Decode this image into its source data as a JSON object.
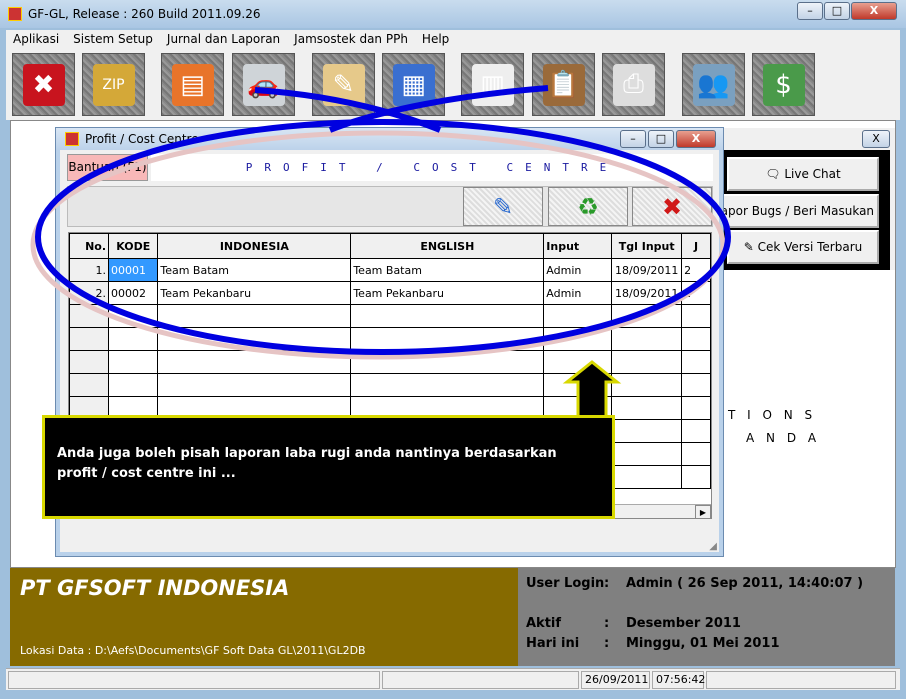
{
  "app": {
    "title": "GF-GL, Release : 260 Build 2011.09.26",
    "min": "–",
    "max": "□",
    "close": "X"
  },
  "menu": [
    "Aplikasi",
    "Sistem Setup",
    "Jurnal dan Laporan",
    "Jamsostek dan PPh",
    "Help"
  ],
  "toolbar": [
    {
      "icon": "exit-icon",
      "glyph": "✖",
      "color": "#c8141e"
    },
    {
      "icon": "zip-box-icon",
      "glyph": "ZIP",
      "color": "#d4a838"
    },
    {
      "icon": "card-index-icon",
      "glyph": "▤",
      "color": "#e8742a"
    },
    {
      "icon": "car-icon",
      "glyph": "🚗",
      "color": "#cfd4d8"
    },
    {
      "icon": "document-icon",
      "glyph": "✎",
      "color": "#e6c98a"
    },
    {
      "icon": "spreadsheet-window-icon",
      "glyph": "▦",
      "color": "#3a6fd0"
    },
    {
      "icon": "papers-stamp-icon",
      "glyph": "▥",
      "color": "#eeeeee"
    },
    {
      "icon": "clipboard-icon",
      "glyph": "📋",
      "color": "#9a6a3a"
    },
    {
      "icon": "printer-icon",
      "glyph": "⎙",
      "color": "#dddddd"
    },
    {
      "icon": "users-icon",
      "glyph": "👥",
      "color": "#7aa0c0"
    },
    {
      "icon": "money-icon",
      "glyph": "$",
      "color": "#4a9a4a"
    }
  ],
  "window": {
    "title": "Profit / Cost Centre",
    "help_button": "Bantuan (F1)",
    "heading": "PROFIT / COST CENTRE"
  },
  "grid": {
    "columns": [
      "No.",
      "KODE",
      "INDONESIA",
      "ENGLISH",
      "Input",
      "Tgl Input",
      "J"
    ],
    "rows": [
      [
        "1.",
        "00001",
        "Team Batam",
        "Team Batam",
        "Admin",
        "18/09/2011",
        "2"
      ],
      [
        "2.",
        "00002",
        "Team Pekanbaru",
        "Team Pekanbaru",
        "Admin",
        "18/09/2011",
        "2"
      ]
    ]
  },
  "right_panel": {
    "close": "X",
    "live_chat": "Live Chat",
    "bug_report": "Lapor Bugs / Beri Masukan",
    "check_version": "Cek Versi Terbaru"
  },
  "background_text": {
    "line1": "T I O N S",
    "line2": "A N D A"
  },
  "callout": {
    "text": "Anda juga boleh pisah laporan laba rugi anda nantinya berdasarkan profit / cost centre ini ..."
  },
  "footer": {
    "company": "PT GFSOFT INDONESIA",
    "data_location": "Lokasi Data :  D:\\Aefs\\Documents\\GF Soft Data GL\\2011\\GL2DB",
    "user_login_label": "User Login",
    "user_login_value": "Admin  ( 26 Sep 2011, 14:40:07 )",
    "active_label": "Aktif",
    "active_value": "Desember 2011",
    "today_label": "Hari ini",
    "today_value": "Minggu, 01 Mei 2011",
    "sep": ":"
  },
  "status": {
    "date": "26/09/2011",
    "time": "07:56:42"
  },
  "colors": {
    "annotation": "#0000e0",
    "callout_border": "#d8d800",
    "company_panel": "#866a00",
    "info_panel": "#808080"
  }
}
